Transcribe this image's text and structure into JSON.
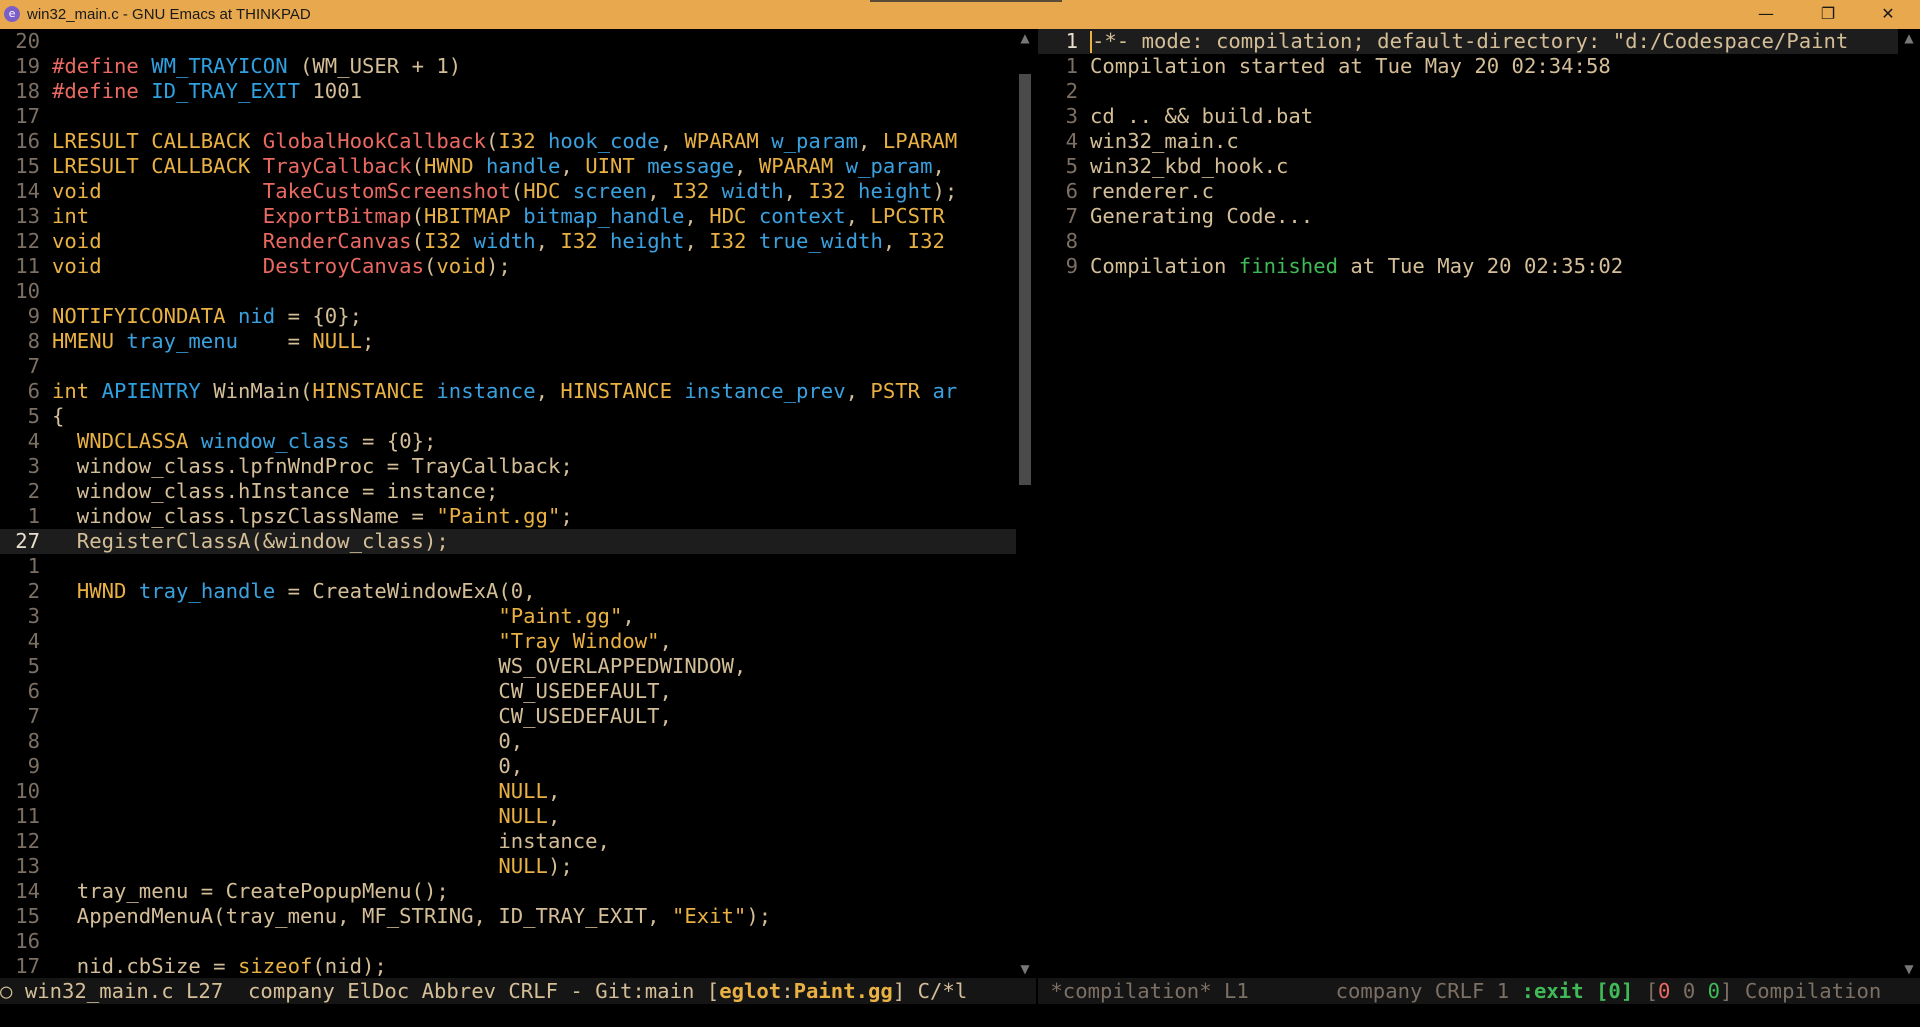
{
  "titlebar": {
    "app_icon": "emacs-icon",
    "title": "win32_main.c - GNU Emacs at THINKPAD",
    "minimize": "—",
    "maximize": "❐",
    "close": "✕"
  },
  "left_pane": {
    "lines": [
      {
        "n": "20",
        "s": []
      },
      {
        "n": "19",
        "s": [
          {
            "c": "k-pre",
            "t": "#define"
          },
          {
            "t": " "
          },
          {
            "c": "k-mac",
            "t": "WM_TRAYICON"
          },
          {
            "t": " (WM_USER + 1)"
          }
        ]
      },
      {
        "n": "18",
        "s": [
          {
            "c": "k-pre",
            "t": "#define"
          },
          {
            "t": " "
          },
          {
            "c": "k-mac",
            "t": "ID_TRAY_EXIT"
          },
          {
            "t": " 1001"
          }
        ]
      },
      {
        "n": "17",
        "s": []
      },
      {
        "n": "16",
        "s": [
          {
            "c": "k-type",
            "t": "LRESULT CALLBACK"
          },
          {
            "t": " "
          },
          {
            "c": "k-fn",
            "t": "GlobalHookCallback"
          },
          {
            "t": "("
          },
          {
            "c": "k-type",
            "t": "I32"
          },
          {
            "t": " "
          },
          {
            "c": "k-var",
            "t": "hook_code"
          },
          {
            "t": ", "
          },
          {
            "c": "k-type",
            "t": "WPARAM"
          },
          {
            "t": " "
          },
          {
            "c": "k-var",
            "t": "w_param"
          },
          {
            "t": ", "
          },
          {
            "c": "k-type",
            "t": "LPARAM"
          }
        ]
      },
      {
        "n": "15",
        "s": [
          {
            "c": "k-type",
            "t": "LRESULT CALLBACK"
          },
          {
            "t": " "
          },
          {
            "c": "k-fn",
            "t": "TrayCallback"
          },
          {
            "t": "("
          },
          {
            "c": "k-type",
            "t": "HWND"
          },
          {
            "t": " "
          },
          {
            "c": "k-var",
            "t": "handle"
          },
          {
            "t": ", "
          },
          {
            "c": "k-type",
            "t": "UINT"
          },
          {
            "t": " "
          },
          {
            "c": "k-var",
            "t": "message"
          },
          {
            "t": ", "
          },
          {
            "c": "k-type",
            "t": "WPARAM"
          },
          {
            "t": " "
          },
          {
            "c": "k-var",
            "t": "w_param"
          },
          {
            "t": ","
          }
        ]
      },
      {
        "n": "14",
        "s": [
          {
            "c": "k-type",
            "t": "void"
          },
          {
            "t": "             "
          },
          {
            "c": "k-fn",
            "t": "TakeCustomScreenshot"
          },
          {
            "t": "("
          },
          {
            "c": "k-type",
            "t": "HDC"
          },
          {
            "t": " "
          },
          {
            "c": "k-var",
            "t": "screen"
          },
          {
            "t": ", "
          },
          {
            "c": "k-type",
            "t": "I32"
          },
          {
            "t": " "
          },
          {
            "c": "k-var",
            "t": "width"
          },
          {
            "t": ", "
          },
          {
            "c": "k-type",
            "t": "I32"
          },
          {
            "t": " "
          },
          {
            "c": "k-var",
            "t": "height"
          },
          {
            "t": ");"
          }
        ]
      },
      {
        "n": "13",
        "s": [
          {
            "c": "k-type",
            "t": "int"
          },
          {
            "t": "              "
          },
          {
            "c": "k-fn",
            "t": "ExportBitmap"
          },
          {
            "t": "("
          },
          {
            "c": "k-type",
            "t": "HBITMAP"
          },
          {
            "t": " "
          },
          {
            "c": "k-var",
            "t": "bitmap_handle"
          },
          {
            "t": ", "
          },
          {
            "c": "k-type",
            "t": "HDC"
          },
          {
            "t": " "
          },
          {
            "c": "k-var",
            "t": "context"
          },
          {
            "t": ", "
          },
          {
            "c": "k-type",
            "t": "LPCSTR"
          }
        ]
      },
      {
        "n": "12",
        "s": [
          {
            "c": "k-type",
            "t": "void"
          },
          {
            "t": "             "
          },
          {
            "c": "k-fn",
            "t": "RenderCanvas"
          },
          {
            "t": "("
          },
          {
            "c": "k-type",
            "t": "I32"
          },
          {
            "t": " "
          },
          {
            "c": "k-var",
            "t": "width"
          },
          {
            "t": ", "
          },
          {
            "c": "k-type",
            "t": "I32"
          },
          {
            "t": " "
          },
          {
            "c": "k-var",
            "t": "height"
          },
          {
            "t": ", "
          },
          {
            "c": "k-type",
            "t": "I32"
          },
          {
            "t": " "
          },
          {
            "c": "k-var",
            "t": "true_width"
          },
          {
            "t": ", "
          },
          {
            "c": "k-type",
            "t": "I32"
          }
        ]
      },
      {
        "n": "11",
        "s": [
          {
            "c": "k-type",
            "t": "void"
          },
          {
            "t": "             "
          },
          {
            "c": "k-fn",
            "t": "DestroyCanvas"
          },
          {
            "t": "("
          },
          {
            "c": "k-type",
            "t": "void"
          },
          {
            "t": ");"
          }
        ]
      },
      {
        "n": "10",
        "s": []
      },
      {
        "n": "9",
        "s": [
          {
            "c": "k-type",
            "t": "NOTIFYICONDATA"
          },
          {
            "t": " "
          },
          {
            "c": "k-var",
            "t": "nid"
          },
          {
            "t": " = {0};"
          }
        ]
      },
      {
        "n": "8",
        "s": [
          {
            "c": "k-type",
            "t": "HMENU"
          },
          {
            "t": " "
          },
          {
            "c": "k-var",
            "t": "tray_menu"
          },
          {
            "t": "    = "
          },
          {
            "c": "k-type",
            "t": "NULL"
          },
          {
            "t": ";"
          }
        ]
      },
      {
        "n": "7",
        "s": []
      },
      {
        "n": "6",
        "s": [
          {
            "c": "k-type",
            "t": "int"
          },
          {
            "t": " "
          },
          {
            "c": "k-mac",
            "t": "APIENTRY"
          },
          {
            "t": " WinMain("
          },
          {
            "c": "k-type",
            "t": "HINSTANCE"
          },
          {
            "t": " "
          },
          {
            "c": "k-var",
            "t": "instance"
          },
          {
            "t": ", "
          },
          {
            "c": "k-type",
            "t": "HINSTANCE"
          },
          {
            "t": " "
          },
          {
            "c": "k-var",
            "t": "instance_prev"
          },
          {
            "t": ", "
          },
          {
            "c": "k-type",
            "t": "PSTR"
          },
          {
            "t": " "
          },
          {
            "c": "k-var",
            "t": "ar"
          }
        ]
      },
      {
        "n": "5",
        "s": [
          {
            "t": "{"
          }
        ]
      },
      {
        "n": "4",
        "s": [
          {
            "t": "  "
          },
          {
            "c": "k-type",
            "t": "WNDCLASSA"
          },
          {
            "t": " "
          },
          {
            "c": "k-var",
            "t": "window_class"
          },
          {
            "t": " = {0};"
          }
        ]
      },
      {
        "n": "3",
        "s": [
          {
            "t": "  window_class.lpfnWndProc = TrayCallback;"
          }
        ]
      },
      {
        "n": "2",
        "s": [
          {
            "t": "  window_class.hInstance = instance;"
          }
        ]
      },
      {
        "n": "1",
        "s": [
          {
            "t": "  window_class.lpszClassName = "
          },
          {
            "c": "k-str",
            "t": "\"Paint.gg\""
          },
          {
            "t": ";"
          }
        ]
      },
      {
        "n": "27",
        "current": true,
        "s": [
          {
            "t": "  RegisterClassA(&window_class);"
          }
        ]
      },
      {
        "n": "1",
        "s": []
      },
      {
        "n": "2",
        "s": [
          {
            "t": "  "
          },
          {
            "c": "k-type",
            "t": "HWND"
          },
          {
            "t": " "
          },
          {
            "c": "k-var",
            "t": "tray_handle"
          },
          {
            "t": " = CreateWindowExA(0,"
          }
        ]
      },
      {
        "n": "3",
        "s": [
          {
            "t": "                                    "
          },
          {
            "c": "k-str",
            "t": "\"Paint.gg\""
          },
          {
            "t": ","
          }
        ]
      },
      {
        "n": "4",
        "s": [
          {
            "t": "                                    "
          },
          {
            "c": "k-str",
            "t": "\"Tray Window\""
          },
          {
            "t": ","
          }
        ]
      },
      {
        "n": "5",
        "s": [
          {
            "t": "                                    WS_OVERLAPPEDWINDOW,"
          }
        ]
      },
      {
        "n": "6",
        "s": [
          {
            "t": "                                    CW_USEDEFAULT,"
          }
        ]
      },
      {
        "n": "7",
        "s": [
          {
            "t": "                                    CW_USEDEFAULT,"
          }
        ]
      },
      {
        "n": "8",
        "s": [
          {
            "t": "                                    0,"
          }
        ]
      },
      {
        "n": "9",
        "s": [
          {
            "t": "                                    0,"
          }
        ]
      },
      {
        "n": "10",
        "s": [
          {
            "t": "                                    "
          },
          {
            "c": "k-type",
            "t": "NULL"
          },
          {
            "t": ","
          }
        ]
      },
      {
        "n": "11",
        "s": [
          {
            "t": "                                    "
          },
          {
            "c": "k-type",
            "t": "NULL"
          },
          {
            "t": ","
          }
        ]
      },
      {
        "n": "12",
        "s": [
          {
            "t": "                                    instance,"
          }
        ]
      },
      {
        "n": "13",
        "s": [
          {
            "t": "                                    "
          },
          {
            "c": "k-type",
            "t": "NULL"
          },
          {
            "t": ");"
          }
        ]
      },
      {
        "n": "14",
        "s": [
          {
            "t": "  tray_menu = CreatePopupMenu();"
          }
        ]
      },
      {
        "n": "15",
        "s": [
          {
            "t": "  AppendMenuA(tray_menu, MF_STRING, ID_TRAY_EXIT, "
          },
          {
            "c": "k-str",
            "t": "\"Exit\""
          },
          {
            "t": ");"
          }
        ]
      },
      {
        "n": "16",
        "s": []
      },
      {
        "n": "17",
        "s": [
          {
            "t": "  nid.cbSize = "
          },
          {
            "c": "k-type",
            "t": "sizeof"
          },
          {
            "t": "(nid);"
          }
        ]
      }
    ]
  },
  "right_pane": {
    "lines": [
      {
        "n": "1",
        "current": true,
        "cursor": true,
        "s": [
          {
            "t": "-*- mode: compilation; default-directory: \"d:/Codespace/Paint"
          }
        ]
      },
      {
        "n": "1",
        "s": [
          {
            "t": "Compilation started at Tue May 20 02:34:58"
          }
        ]
      },
      {
        "n": "2",
        "s": []
      },
      {
        "n": "3",
        "s": [
          {
            "t": "cd .. && build.bat"
          }
        ]
      },
      {
        "n": "4",
        "s": [
          {
            "t": "win32_main.c"
          }
        ]
      },
      {
        "n": "5",
        "s": [
          {
            "t": "win32_kbd_hook.c"
          }
        ]
      },
      {
        "n": "6",
        "s": [
          {
            "t": "renderer.c"
          }
        ]
      },
      {
        "n": "7",
        "s": [
          {
            "t": "Generating Code..."
          }
        ]
      },
      {
        "n": "8",
        "s": []
      },
      {
        "n": "9",
        "s": [
          {
            "t": "Compilation "
          },
          {
            "c": "k-green",
            "t": "finished"
          },
          {
            "t": " at Tue May 20 02:35:02"
          }
        ]
      }
    ]
  },
  "modeline_left": {
    "indicator": "○",
    "buffer": "win32_main.c",
    "position": "L27",
    "modes": "company ElDoc Abbrev CRLF - Git:main",
    "eglot_open": "[",
    "eglot": "eglot",
    "eglot_sep": ":",
    "eglot_project": "Paint.gg",
    "eglot_close": "]",
    "major_mode": "C/*l"
  },
  "modeline_right": {
    "buffer": "*compilation*",
    "position": "L1",
    "modes": "company CRLF 1",
    "exit_label": ":exit",
    "exit_code": "[0]",
    "counts_open": "[",
    "count_errors": "0",
    "count_warnings": "0",
    "count_infos": "0",
    "counts_close": "]",
    "major_mode": "Compilation"
  },
  "scrollbars": {
    "left_position_fraction": 0.03,
    "left_visible_fraction": 0.45,
    "right_position_fraction": 0.0,
    "right_visible_fraction": 1.0
  },
  "colors": {
    "titlebar": "#e8a94e",
    "background": "#000000",
    "keyword": "#e9b143",
    "function": "#ea6962",
    "variable": "#3aa0de",
    "success": "#3fba57"
  }
}
